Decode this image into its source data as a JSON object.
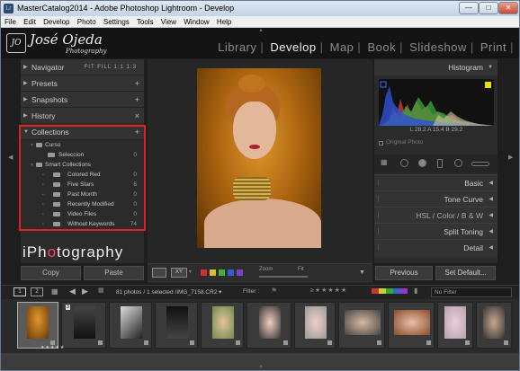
{
  "window": {
    "title": "MasterCatalog2014 - Adobe Photoshop Lightroom - Develop"
  },
  "menu": [
    "File",
    "Edit",
    "Develop",
    "Photo",
    "Settings",
    "Tools",
    "View",
    "Window",
    "Help"
  ],
  "identity": {
    "name": "José Ojeda",
    "sub": "Photography",
    "mark": "JO"
  },
  "modules": [
    "Library",
    "Develop",
    "Map",
    "Book",
    "Slideshow",
    "Print"
  ],
  "active_module": "Develop",
  "left_panel": {
    "navigator": {
      "label": "Navigator",
      "zoom": "FIT  FILL  1:1  1:3"
    },
    "presets": "Presets",
    "snapshots": "Snapshots",
    "history": "History",
    "collections": "Collections",
    "coll_items": [
      {
        "name": "Curso",
        "count": ""
      },
      {
        "name": "Seleccion",
        "count": "0"
      },
      {
        "name": "Smart Collections",
        "count": ""
      },
      {
        "name": "Colored Red",
        "count": "0"
      },
      {
        "name": "Five Stars",
        "count": "6"
      },
      {
        "name": "Past Month",
        "count": "0"
      },
      {
        "name": "Recently Modified",
        "count": "0"
      },
      {
        "name": "Video Files",
        "count": "0"
      },
      {
        "name": "Without Keywords",
        "count": "74"
      }
    ],
    "branding": {
      "pre": "iPh",
      "o": "o",
      "post": "tography",
      "sub": "José Ojeda"
    }
  },
  "buttons": {
    "copy": "Copy",
    "paste": "Paste",
    "previous": "Previous",
    "set_default": "Set Default..."
  },
  "toolbar": {
    "zoom_label": "Zoom",
    "fit_label": "Fit",
    "compare": "XY"
  },
  "right_panel": {
    "histogram": "Histogram",
    "info": "L   28.2   A   15.4   B   29.2",
    "original_photo": "Original Photo",
    "sections": [
      "Basic",
      "Tone Curve",
      "HSL  /  Color  /  B & W",
      "Split Toning",
      "Detail"
    ]
  },
  "filmbar": {
    "page1": "1",
    "page2": "2",
    "info": "81 photos / 1 selected /IMG_7158.CR2 ▾",
    "filter_label": "Filter :",
    "filter_value": "No Filter"
  },
  "thumbnails": [
    {
      "badge": ""
    },
    {
      "badge": "3"
    },
    {
      "badge": ""
    },
    {
      "badge": ""
    },
    {
      "badge": ""
    },
    {
      "badge": ""
    },
    {
      "badge": ""
    },
    {
      "badge": ""
    },
    {
      "badge": ""
    },
    {
      "badge": ""
    },
    {
      "badge": ""
    }
  ],
  "colors": {
    "accent_red": "#e02020",
    "swatches": [
      "#d03030",
      "#d8c030",
      "#40b040",
      "#3060d0",
      "#8040c0"
    ]
  }
}
